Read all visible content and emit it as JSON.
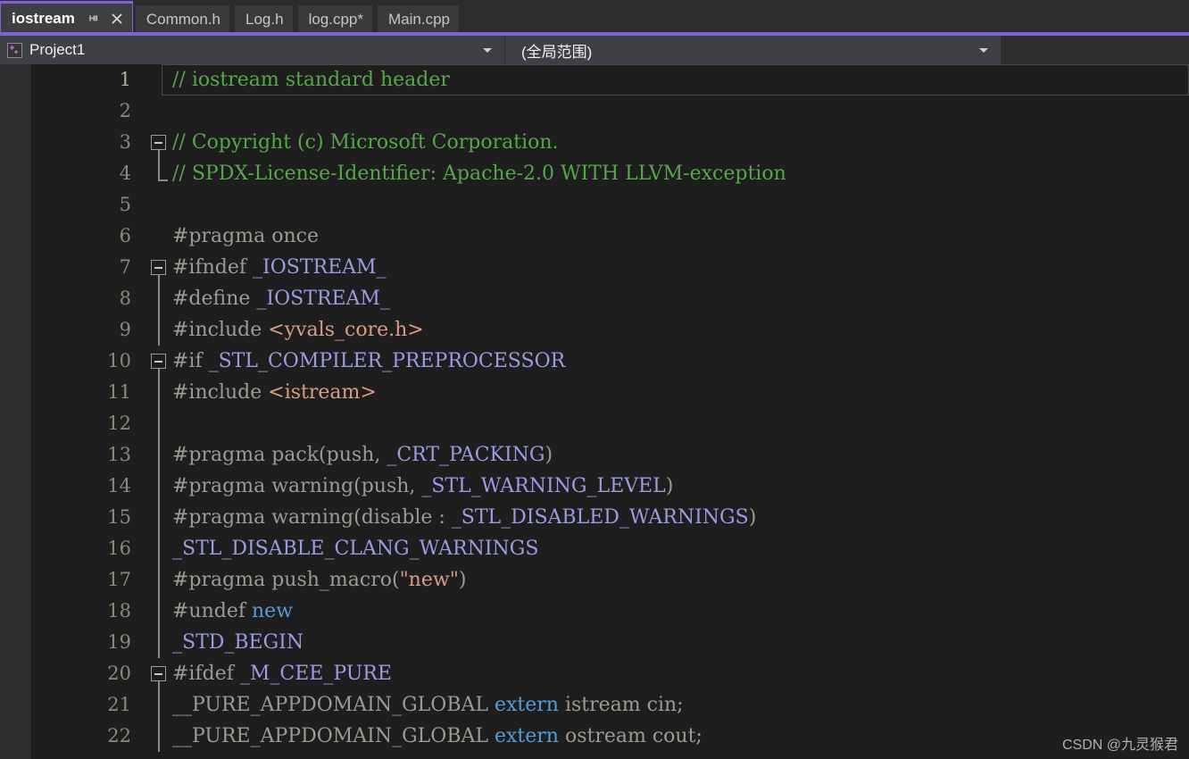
{
  "window": {
    "accent_color": "#8161d6",
    "editor_background": "#1e1e1e",
    "chrome_background": "#2d2d30"
  },
  "tabstrip": {
    "tabs": [
      {
        "label": "iostream",
        "active": true,
        "modified": false,
        "pin_icon": "pin-icon",
        "close_icon": "close-icon"
      },
      {
        "label": "Common.h",
        "active": false,
        "modified": false
      },
      {
        "label": "Log.h",
        "active": false,
        "modified": false
      },
      {
        "label": "log.cpp*",
        "active": false,
        "modified": true
      },
      {
        "label": "Main.cpp",
        "active": false,
        "modified": false
      }
    ]
  },
  "navbar": {
    "project_icon": "cpp-project-icon",
    "project_label": "Project1",
    "scope_label": "(全局范围)",
    "chevron_icon": "chevron-down-icon"
  },
  "editor": {
    "language": "cpp",
    "current_line": 1,
    "first_visible_line": 1,
    "last_visible_line": 22,
    "colors": {
      "comment": "#57a64a",
      "preprocessor": "#9b9b93",
      "macro": "#9b9bdf",
      "string": "#d69d85",
      "include_path": "#d69d85",
      "keyword": "#569cd6",
      "identifier": "#9b9b93",
      "line_number": "#8a8a7a"
    },
    "lines": [
      {
        "n": "1",
        "fold": "none",
        "current": true,
        "tokens": [
          {
            "t": "// iostream standard header",
            "c": "cm"
          }
        ]
      },
      {
        "n": "2",
        "fold": "none",
        "tokens": []
      },
      {
        "n": "3",
        "fold": "open",
        "tokens": [
          {
            "t": "// Copyright (c) Microsoft Corporation.",
            "c": "cm"
          }
        ]
      },
      {
        "n": "4",
        "fold": "end",
        "tokens": [
          {
            "t": "// SPDX-License-Identifier: Apache-2.0 WITH LLVM-exception",
            "c": "cm"
          }
        ]
      },
      {
        "n": "5",
        "fold": "none",
        "tokens": []
      },
      {
        "n": "6",
        "fold": "none",
        "tokens": [
          {
            "t": "#pragma once",
            "c": "pp"
          }
        ]
      },
      {
        "n": "7",
        "fold": "open",
        "tokens": [
          {
            "t": "#ifndef ",
            "c": "pp"
          },
          {
            "t": "_IOSTREAM_",
            "c": "mac"
          }
        ]
      },
      {
        "n": "8",
        "fold": "bar",
        "tokens": [
          {
            "t": "#define ",
            "c": "pp"
          },
          {
            "t": "_IOSTREAM_",
            "c": "mac"
          }
        ]
      },
      {
        "n": "9",
        "fold": "bar",
        "tokens": [
          {
            "t": "#include ",
            "c": "pp"
          },
          {
            "t": "<yvals_core.h>",
            "c": "inc"
          }
        ]
      },
      {
        "n": "10",
        "fold": "open",
        "tokens": [
          {
            "t": "#if ",
            "c": "pp"
          },
          {
            "t": "_STL_COMPILER_PREPROCESSOR",
            "c": "mac"
          }
        ]
      },
      {
        "n": "11",
        "fold": "bar",
        "tokens": [
          {
            "t": "#include ",
            "c": "pp"
          },
          {
            "t": "<istream>",
            "c": "inc"
          }
        ]
      },
      {
        "n": "12",
        "fold": "bar",
        "tokens": []
      },
      {
        "n": "13",
        "fold": "bar",
        "tokens": [
          {
            "t": "#pragma pack(push, ",
            "c": "pp"
          },
          {
            "t": "_CRT_PACKING",
            "c": "mac"
          },
          {
            "t": ")",
            "c": "pp"
          }
        ]
      },
      {
        "n": "14",
        "fold": "bar",
        "tokens": [
          {
            "t": "#pragma warning(push, ",
            "c": "pp"
          },
          {
            "t": "_STL_WARNING_LEVEL",
            "c": "mac"
          },
          {
            "t": ")",
            "c": "pp"
          }
        ]
      },
      {
        "n": "15",
        "fold": "bar",
        "tokens": [
          {
            "t": "#pragma warning(disable : ",
            "c": "pp"
          },
          {
            "t": "_STL_DISABLED_WARNINGS",
            "c": "mac"
          },
          {
            "t": ")",
            "c": "pp"
          }
        ]
      },
      {
        "n": "16",
        "fold": "bar",
        "tokens": [
          {
            "t": "_STL_DISABLE_CLANG_WARNINGS",
            "c": "mac"
          }
        ]
      },
      {
        "n": "17",
        "fold": "bar",
        "tokens": [
          {
            "t": "#pragma push_macro(",
            "c": "pp"
          },
          {
            "t": "\"new\"",
            "c": "str"
          },
          {
            "t": ")",
            "c": "pp"
          }
        ]
      },
      {
        "n": "18",
        "fold": "bar",
        "tokens": [
          {
            "t": "#undef ",
            "c": "pp"
          },
          {
            "t": "new",
            "c": "kw"
          }
        ]
      },
      {
        "n": "19",
        "fold": "bar",
        "tokens": [
          {
            "t": "_STD_BEGIN",
            "c": "mac"
          }
        ]
      },
      {
        "n": "20",
        "fold": "open",
        "tokens": [
          {
            "t": "#ifdef ",
            "c": "pp"
          },
          {
            "t": "_M_CEE_PURE",
            "c": "mac"
          }
        ]
      },
      {
        "n": "21",
        "fold": "bar",
        "tokens": [
          {
            "t": "__PURE_APPDOMAIN_GLOBAL ",
            "c": "idn"
          },
          {
            "t": "extern",
            "c": "kw"
          },
          {
            "t": " istream cin;",
            "c": "idn"
          }
        ]
      },
      {
        "n": "22",
        "fold": "bar",
        "tokens": [
          {
            "t": "__PURE_APPDOMAIN_GLOBAL ",
            "c": "idn"
          },
          {
            "t": "extern",
            "c": "kw"
          },
          {
            "t": " ostream cout;",
            "c": "idn"
          }
        ]
      }
    ]
  },
  "watermark": {
    "text": "CSDN @九灵猴君"
  }
}
